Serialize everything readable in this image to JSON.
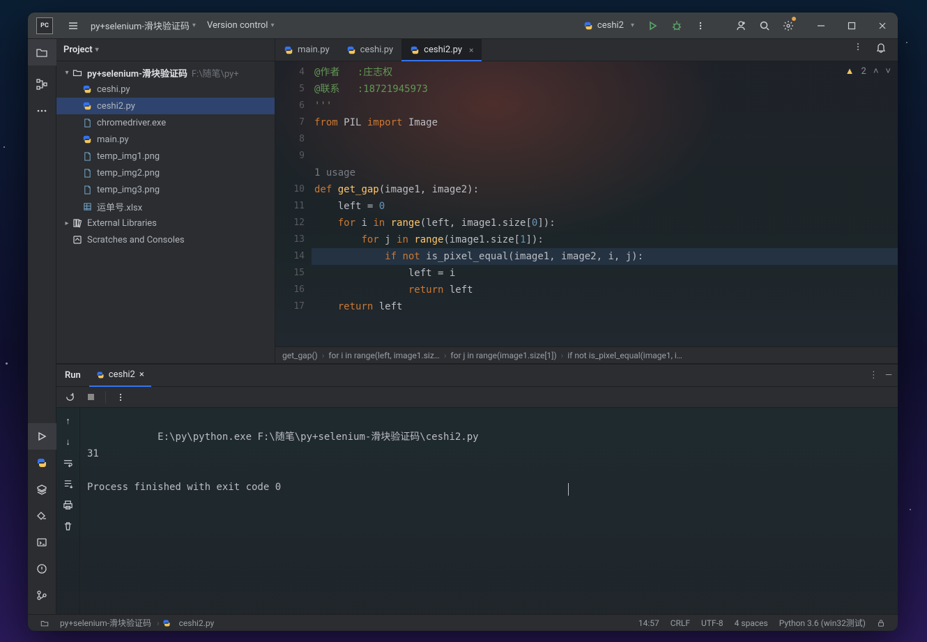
{
  "titlebar": {
    "project_name": "py+selenium-滑块验证码",
    "version_control": "Version control",
    "run_config": "ceshi2"
  },
  "project_panel": {
    "title": "Project",
    "root": {
      "name": "py+selenium-滑块验证码",
      "path": "F:\\随笔\\py+"
    },
    "files": [
      {
        "name": "ceshi.py",
        "icon": "py"
      },
      {
        "name": "ceshi2.py",
        "icon": "py",
        "selected": true
      },
      {
        "name": "chromedriver.exe",
        "icon": "file"
      },
      {
        "name": "main.py",
        "icon": "py"
      },
      {
        "name": "temp_img1.png",
        "icon": "file"
      },
      {
        "name": "temp_img2.png",
        "icon": "file"
      },
      {
        "name": "temp_img3.png",
        "icon": "file"
      },
      {
        "name": "运单号.xlsx",
        "icon": "xlsx"
      }
    ],
    "external": "External Libraries",
    "scratches": "Scratches and Consoles"
  },
  "editor": {
    "tabs": [
      {
        "name": "main.py",
        "active": false
      },
      {
        "name": "ceshi.py",
        "active": false
      },
      {
        "name": "ceshi2.py",
        "active": true
      }
    ],
    "warn_count": "2",
    "gutter_start": 4,
    "gutter_end": 17,
    "usage_inlay": "1 usage",
    "code_lines": [
      {
        "n": 4,
        "html": "<span class='doc'>@作者&nbsp;&nbsp;&nbsp;:庄志权</span>"
      },
      {
        "n": 5,
        "html": "<span class='doc'>@联系&nbsp;&nbsp;&nbsp;:18721945973</span>"
      },
      {
        "n": 6,
        "html": "<span class='str'>'''</span>"
      },
      {
        "n": 7,
        "html": "<span class='kw'>from</span> PIL <span class='kw'>import</span> Image"
      },
      {
        "n": 8,
        "html": ""
      },
      {
        "n": 9,
        "html": ""
      },
      {
        "n": "",
        "html": "<span class='inlay'>1 usage</span>"
      },
      {
        "n": 10,
        "html": "<span class='kw'>def</span> <span class='fn'>get_gap</span>(image1, image2):"
      },
      {
        "n": 11,
        "html": "    left = <span class='num'>0</span>"
      },
      {
        "n": 12,
        "html": "    <span class='kw'>for</span> i <span class='kw'>in</span> <span class='fn'>range</span>(left, image1.size[<span class='num'>0</span>]):"
      },
      {
        "n": 13,
        "html": "        <span class='kw'>for</span> j <span class='kw'>in</span> <span class='fn'>range</span>(image1.size[<span class='num'>1</span>]):"
      },
      {
        "n": 14,
        "html": "            <span class='kw'>if</span> <span class='kw'>not</span> is_pixel_equal(image1, image2, i, j):",
        "hl": true,
        "bulb": true
      },
      {
        "n": 15,
        "html": "                left = i"
      },
      {
        "n": 16,
        "html": "                <span class='kw'>return</span> left"
      },
      {
        "n": 17,
        "html": "    <span class='kw'>return</span> left"
      }
    ],
    "breadcrumbs": [
      "get_gap()",
      "for i in range(left, image1.siz…",
      "for j in range(image1.size[1])",
      "if not is_pixel_equal(image1, i…"
    ]
  },
  "run": {
    "title": "Run",
    "config": "ceshi2",
    "console": "E:\\py\\python.exe F:\\随笔\\py+selenium-滑块验证码\\ceshi2.py\n31\n\nProcess finished with exit code 0"
  },
  "statusbar": {
    "path_root": "py+selenium-滑块验证码",
    "path_file": "ceshi2.py",
    "time": "14:57",
    "crlf": "CRLF",
    "enc": "UTF-8",
    "indent": "4 spaces",
    "interp": "Python 3.6 (win32测试)"
  }
}
